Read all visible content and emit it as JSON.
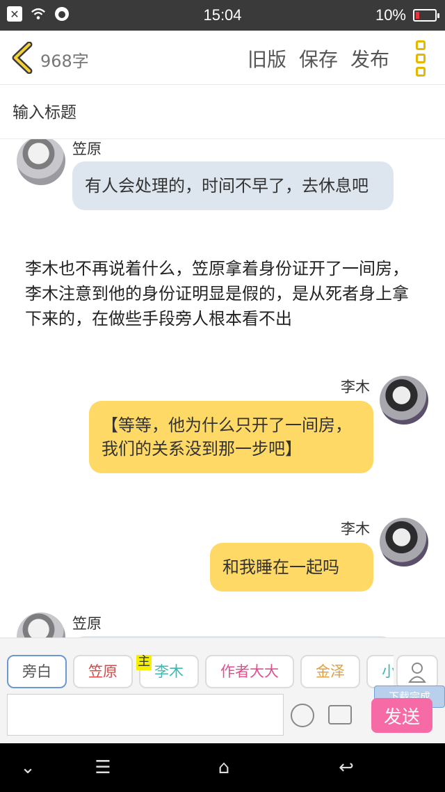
{
  "status_bar": {
    "time": "15:04",
    "battery": "10%"
  },
  "header": {
    "word_count": "968字",
    "actions": [
      "旧版",
      "保存",
      "发布"
    ]
  },
  "title_placeholder": "输入标题",
  "chat": {
    "msg1": {
      "name": "笠原",
      "text": "有人会处理的，时间不早了，去休息吧"
    },
    "narration": "李木也不再说着什么，笠原拿着身份证开了一间房，李木注意到他的身份证明显是假的，是从死者身上拿下来的，在做些手段旁人根本看不出",
    "msg2": {
      "name": "李木",
      "text": "【等等，他为什么只开了一间房，我们的关系没到那一步吧】"
    },
    "msg3": {
      "name": "李木",
      "text": "和我睡在一起吗"
    },
    "msg4": {
      "name": "笠原"
    }
  },
  "roles": [
    {
      "label": "旁白",
      "color": "#555555"
    },
    {
      "label": "笠原",
      "color": "#d44a4a"
    },
    {
      "label": "李木",
      "color": "#3fb7b0",
      "tag": "主"
    },
    {
      "label": "作者大大",
      "color": "#e0508f"
    },
    {
      "label": "金泽",
      "color": "#e0a040"
    },
    {
      "label": "小刘",
      "color": "#3fb7b0"
    }
  ],
  "toast": "下载完成",
  "send_label": "发送"
}
